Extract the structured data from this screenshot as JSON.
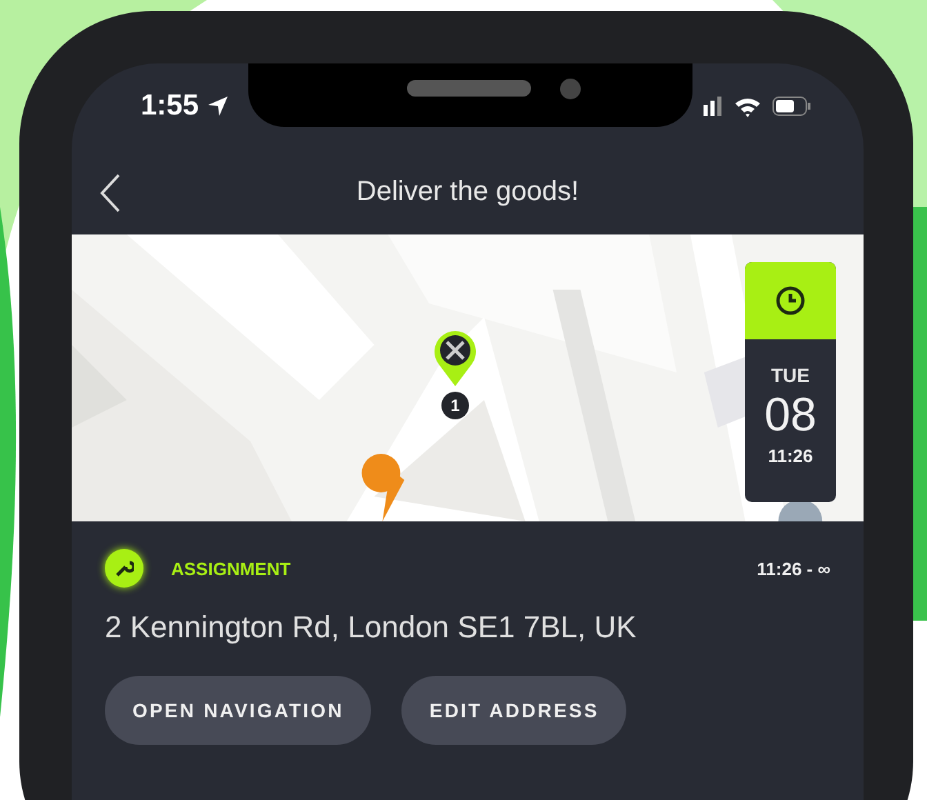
{
  "status_bar": {
    "time": "1:55"
  },
  "nav": {
    "title": "Deliver the goods!"
  },
  "map": {
    "pin": {
      "label": "1"
    },
    "date_card": {
      "day": "TUE",
      "date": "08",
      "time": "11:26"
    }
  },
  "task": {
    "type": "ASSIGNMENT",
    "time_range": "11:26 - ∞",
    "address": "2 Kennington Rd, London SE1 7BL, UK",
    "buttons": [
      "OPEN NAVIGATION",
      "EDIT ADDRESS"
    ]
  }
}
